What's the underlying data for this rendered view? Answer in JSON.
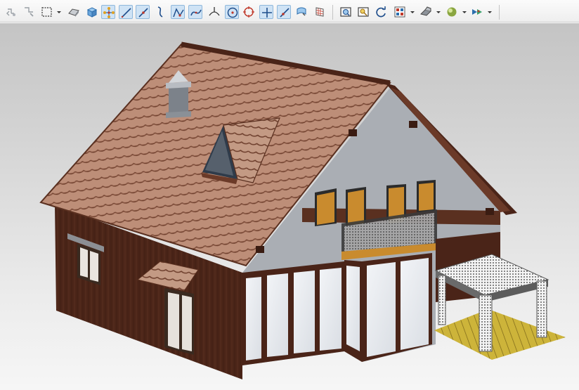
{
  "toolbar": {
    "buttons": [
      {
        "name": "undo-selection-icon",
        "active": false
      },
      {
        "name": "select-filter-icon",
        "active": false
      },
      {
        "name": "box-select-icon",
        "active": false,
        "dropdown": true
      },
      {
        "name": "shaded-mode-icon",
        "active": false
      },
      {
        "name": "solid-box-icon",
        "active": false
      },
      {
        "name": "snap-points-icon",
        "active": true
      },
      {
        "name": "line-icon",
        "active": true
      },
      {
        "name": "line-segment-icon",
        "active": true
      },
      {
        "name": "curve-icon",
        "active": false
      },
      {
        "name": "polyline-icon",
        "active": true
      },
      {
        "name": "spline-icon",
        "active": true
      },
      {
        "name": "normal-icon",
        "active": false
      },
      {
        "name": "circle-center-icon",
        "active": true
      },
      {
        "name": "circle-target-icon",
        "active": false
      },
      {
        "name": "crosshair-icon",
        "active": true
      },
      {
        "name": "point-on-curve-icon",
        "active": true
      },
      {
        "name": "surface-icon",
        "active": false
      },
      {
        "name": "grid-icon",
        "active": false
      },
      {
        "name": "zoom-fit-icon",
        "active": false
      },
      {
        "name": "zoom-window-icon",
        "active": false
      },
      {
        "name": "rotate-view-icon",
        "active": false
      },
      {
        "name": "view-layout-icon",
        "active": false,
        "dropdown": true
      },
      {
        "name": "view-orientation-icon",
        "active": false,
        "dropdown": true
      },
      {
        "name": "render-style-icon",
        "active": false,
        "dropdown": true
      },
      {
        "name": "display-options-icon",
        "active": false,
        "dropdown": true
      }
    ]
  },
  "viewport": {
    "model": "house-model",
    "colors": {
      "roof": "#b88a73",
      "wall_wood": "#4a2418",
      "gable": "#a9adb3",
      "glass": "#e7eaef",
      "deck": "#c8b032",
      "pergola": "#5c5c5c"
    }
  }
}
